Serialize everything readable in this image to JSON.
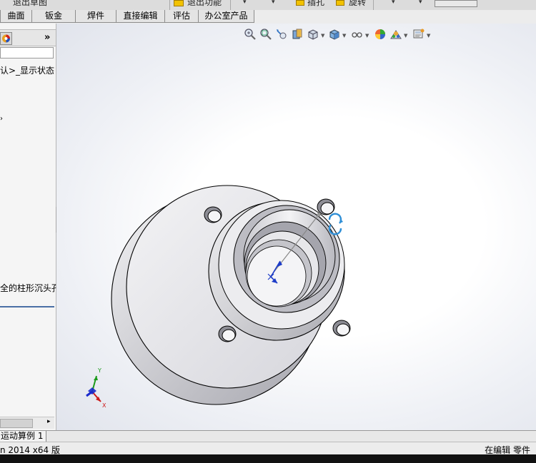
{
  "top_strip": {
    "items": [
      "退出草图",
      "退出功能",
      "插孔",
      "旋转"
    ]
  },
  "tabs": [
    "曲面",
    "钣金",
    "焊件",
    "直接编辑",
    "评估",
    "办公室产品"
  ],
  "left_panel": {
    "more_label": "»",
    "tree_text_1": "认>_显示状态",
    "tree_text_2": "全的柱形沉头孔",
    "scroll_right": "▸"
  },
  "view_toolbar": {
    "icons": [
      "zoom-to-fit-icon",
      "zoom-to-area-icon",
      "previous-view-icon",
      "section-view-icon",
      "view-orientation-icon",
      "display-style-icon",
      "hide-show-items-icon",
      "edit-appearance-icon",
      "apply-scene-icon",
      "view-settings-icon"
    ]
  },
  "triad": {
    "x_label": "X",
    "y_label": "Y"
  },
  "bottom_tab": "运动算例 1",
  "status": {
    "left": "n 2014 x64 版",
    "right": "在编辑 零件"
  }
}
